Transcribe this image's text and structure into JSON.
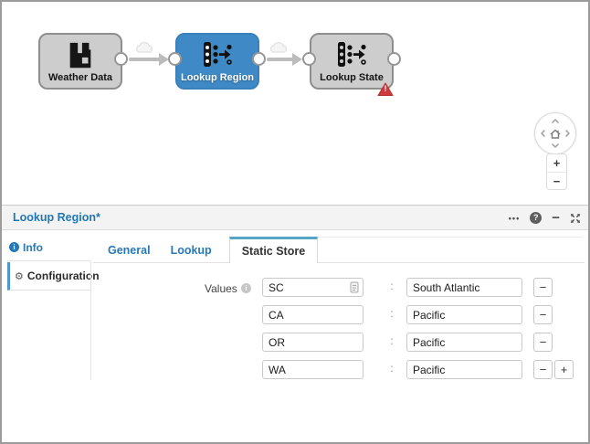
{
  "canvas": {
    "nodes": [
      {
        "label": "Weather Data",
        "state": "default"
      },
      {
        "label": "Lookup Region",
        "state": "selected"
      },
      {
        "label": "Lookup State",
        "state": "error"
      }
    ],
    "error_badge": "!",
    "nav": {
      "zoom_in": "+",
      "zoom_out": "−"
    }
  },
  "panel": {
    "title": "Lookup Region*",
    "icons": {
      "more": "•••",
      "help": "?",
      "minimize": "−"
    },
    "sidebar": {
      "icons": {
        "info": "i",
        "gear": "⚙"
      },
      "items": [
        {
          "label": "Info",
          "active": false
        },
        {
          "label": "Configuration",
          "active": true
        }
      ]
    },
    "tabs": [
      {
        "label": "General",
        "active": false
      },
      {
        "label": "Lookup",
        "active": false
      },
      {
        "label": "Static Store",
        "active": true
      }
    ],
    "form": {
      "label": "Values",
      "info_glyph": "i",
      "separator": ":",
      "rows": [
        {
          "key": "SC",
          "value": "South Atlantic"
        },
        {
          "key": "CA",
          "value": "Pacific"
        },
        {
          "key": "OR",
          "value": "Pacific"
        },
        {
          "key": "WA",
          "value": "Pacific"
        }
      ],
      "remove_label": "−",
      "add_label": "+"
    }
  },
  "colors": {
    "node_gray": "#cdcdcd",
    "node_blue": "#3f8ac6",
    "error_red": "#cf3b3b",
    "title_blue": "#1f78b5",
    "link_blue": "#2878b8",
    "tab_accent": "#55a5c5"
  }
}
